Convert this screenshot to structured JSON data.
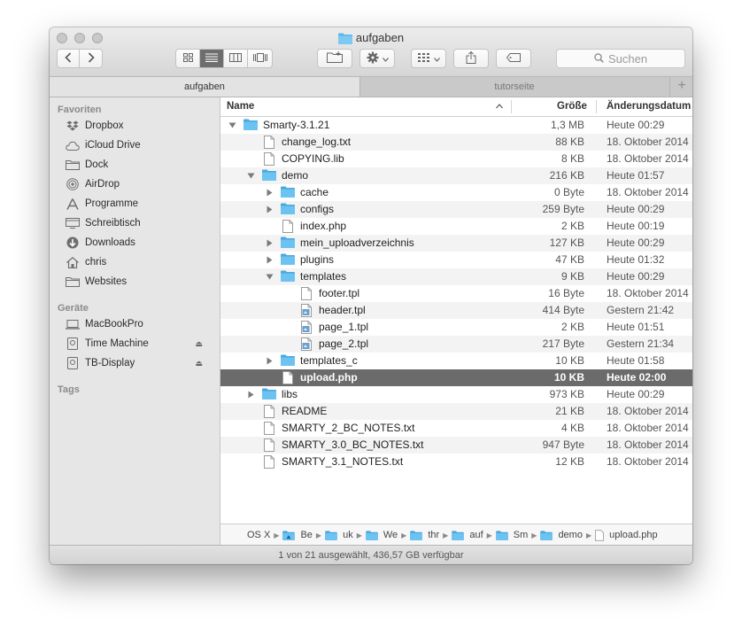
{
  "window": {
    "title": "aufgaben"
  },
  "toolbar": {
    "search_placeholder": "Suchen"
  },
  "tabs": [
    {
      "label": "aufgaben",
      "active": true
    },
    {
      "label": "tutorseite",
      "active": false
    }
  ],
  "tab_add_label": "+",
  "sidebar": {
    "sections": {
      "favorites": "Favoriten",
      "devices": "Geräte",
      "tags": "Tags"
    },
    "favorites": [
      {
        "label": "Dropbox",
        "icon": "dropbox-icon"
      },
      {
        "label": "iCloud Drive",
        "icon": "cloud-icon"
      },
      {
        "label": "Dock",
        "icon": "folder-icon"
      },
      {
        "label": "AirDrop",
        "icon": "airdrop-icon"
      },
      {
        "label": "Programme",
        "icon": "applications-icon"
      },
      {
        "label": "Schreibtisch",
        "icon": "desktop-icon"
      },
      {
        "label": "Downloads",
        "icon": "download-icon"
      },
      {
        "label": "chris",
        "icon": "home-icon"
      },
      {
        "label": "Websites",
        "icon": "folder-icon"
      }
    ],
    "devices": [
      {
        "label": "MacBookPro",
        "icon": "laptop-icon"
      },
      {
        "label": "Time Machine",
        "icon": "disk-icon",
        "eject": "⏏"
      },
      {
        "label": "TB-Display",
        "icon": "disk-icon",
        "eject": "⏏"
      }
    ]
  },
  "columns": {
    "name": "Name",
    "size": "Größe",
    "date": "Änderungsdatum"
  },
  "rows": [
    {
      "name": "Smarty-3.1.21",
      "size": "1,3 MB",
      "date": "Heute 00:29",
      "level": 0,
      "type": "folder",
      "disclosure": "open"
    },
    {
      "name": "change_log.txt",
      "size": "88 KB",
      "date": "18. Oktober 2014",
      "level": 1,
      "type": "doc",
      "disclosure": "none"
    },
    {
      "name": "COPYING.lib",
      "size": "8 KB",
      "date": "18. Oktober 2014",
      "level": 1,
      "type": "doc",
      "disclosure": "none"
    },
    {
      "name": "demo",
      "size": "216 KB",
      "date": "Heute 01:57",
      "level": 1,
      "type": "folder",
      "disclosure": "open"
    },
    {
      "name": "cache",
      "size": "0 Byte",
      "date": "18. Oktober 2014",
      "level": 2,
      "type": "folder",
      "disclosure": "closed"
    },
    {
      "name": "configs",
      "size": "259 Byte",
      "date": "Heute 00:29",
      "level": 2,
      "type": "folder",
      "disclosure": "closed"
    },
    {
      "name": "index.php",
      "size": "2 KB",
      "date": "Heute 00:19",
      "level": 2,
      "type": "doc",
      "disclosure": "none"
    },
    {
      "name": "mein_uploadverzeichnis",
      "size": "127 KB",
      "date": "Heute 00:29",
      "level": 2,
      "type": "folder",
      "disclosure": "closed"
    },
    {
      "name": "plugins",
      "size": "47 KB",
      "date": "Heute 01:32",
      "level": 2,
      "type": "folder",
      "disclosure": "closed"
    },
    {
      "name": "templates",
      "size": "9 KB",
      "date": "Heute 00:29",
      "level": 2,
      "type": "folder",
      "disclosure": "open"
    },
    {
      "name": "footer.tpl",
      "size": "16 Byte",
      "date": "18. Oktober 2014",
      "level": 3,
      "type": "doc",
      "disclosure": "none"
    },
    {
      "name": "header.tpl",
      "size": "414 Byte",
      "date": "Gestern 21:42",
      "level": 3,
      "type": "tpl",
      "disclosure": "none"
    },
    {
      "name": "page_1.tpl",
      "size": "2 KB",
      "date": "Heute 01:51",
      "level": 3,
      "type": "tpl",
      "disclosure": "none"
    },
    {
      "name": "page_2.tpl",
      "size": "217 Byte",
      "date": "Gestern 21:34",
      "level": 3,
      "type": "tpl",
      "disclosure": "none"
    },
    {
      "name": "templates_c",
      "size": "10 KB",
      "date": "Heute 01:58",
      "level": 2,
      "type": "folder",
      "disclosure": "closed"
    },
    {
      "name": "upload.php",
      "size": "10 KB",
      "date": "Heute 02:00",
      "level": 2,
      "type": "doc",
      "disclosure": "none",
      "selected": true
    },
    {
      "name": "libs",
      "size": "973 KB",
      "date": "Heute 00:29",
      "level": 1,
      "type": "folder",
      "disclosure": "closed"
    },
    {
      "name": "README",
      "size": "21 KB",
      "date": "18. Oktober 2014",
      "level": 1,
      "type": "doc",
      "disclosure": "none"
    },
    {
      "name": "SMARTY_2_BC_NOTES.txt",
      "size": "4 KB",
      "date": "18. Oktober 2014",
      "level": 1,
      "type": "doc",
      "disclosure": "none"
    },
    {
      "name": "SMARTY_3.0_BC_NOTES.txt",
      "size": "947 Byte",
      "date": "18. Oktober 2014",
      "level": 1,
      "type": "doc",
      "disclosure": "none"
    },
    {
      "name": "SMARTY_3.1_NOTES.txt",
      "size": "12 KB",
      "date": "18. Oktober 2014",
      "level": 1,
      "type": "doc",
      "disclosure": "none"
    }
  ],
  "pathbar": [
    {
      "label": "OS X",
      "type": "disk"
    },
    {
      "label": "Be",
      "type": "home"
    },
    {
      "label": "uk",
      "type": "folder"
    },
    {
      "label": "We",
      "type": "folder"
    },
    {
      "label": "thr",
      "type": "folder"
    },
    {
      "label": "auf",
      "type": "folder"
    },
    {
      "label": "Sm",
      "type": "folder"
    },
    {
      "label": "demo",
      "type": "folder"
    },
    {
      "label": "upload.php",
      "type": "doc"
    }
  ],
  "status": "1 von 21 ausgewählt, 436,57 GB verfügbar",
  "colors": {
    "folder": "#5bb6ea",
    "selection": "#6b6b6b",
    "window_bg": "#ececec"
  }
}
